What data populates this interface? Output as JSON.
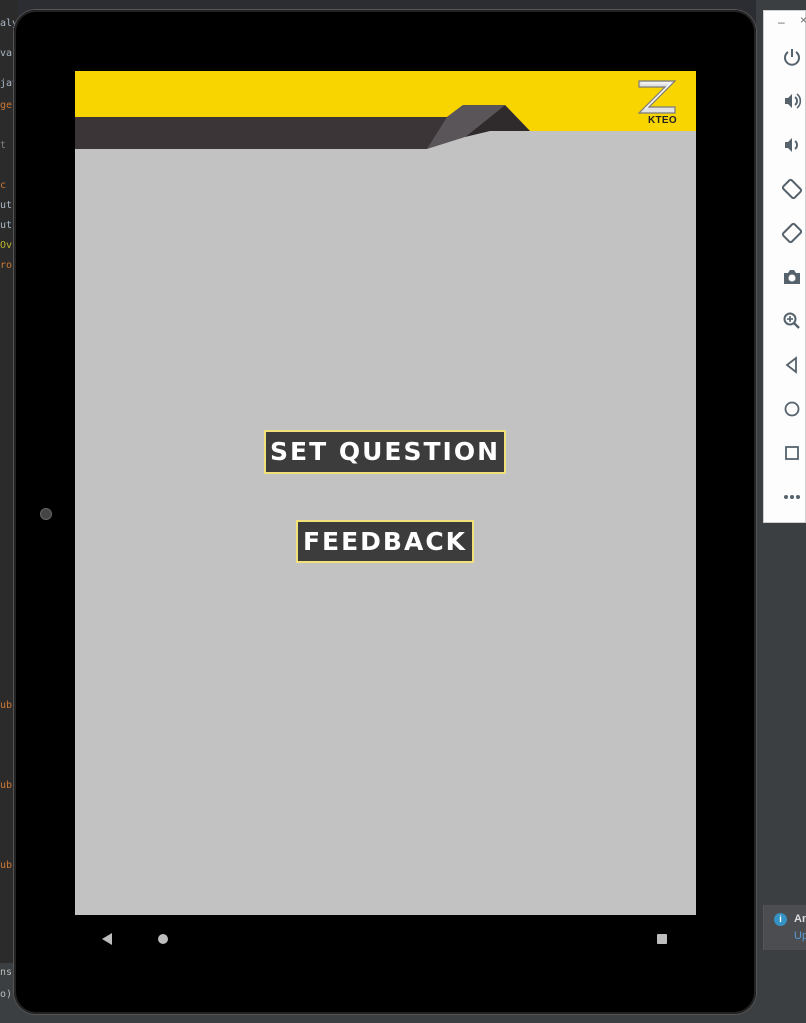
{
  "app": {
    "logo_text": "KTEO"
  },
  "main": {
    "set_question_label": "SET QUESTION",
    "feedback_label": "FEEDBACK"
  },
  "ide": {
    "code_fragments": [
      "aly",
      "va",
      "jav",
      "ge",
      "t",
      "c",
      "ut",
      "ut",
      "Ov",
      "ro",
      "ub",
      "ub",
      "ub",
      "ns",
      "o)"
    ],
    "notification_title": "An",
    "notification_link": "Up"
  },
  "emulator_toolbar": {
    "buttons": [
      "power-icon",
      "volume-up-icon",
      "volume-down-icon",
      "rotate-left-icon",
      "rotate-right-icon",
      "camera-icon",
      "zoom-icon",
      "back-icon",
      "home-icon",
      "overview-icon",
      "more-icon"
    ]
  },
  "colors": {
    "header_yellow": "#f9d500",
    "header_dark": "#3b3537",
    "screen_bg": "#c2c2c2",
    "button_bg": "#3c3c3c",
    "button_border": "#f2e07a"
  }
}
